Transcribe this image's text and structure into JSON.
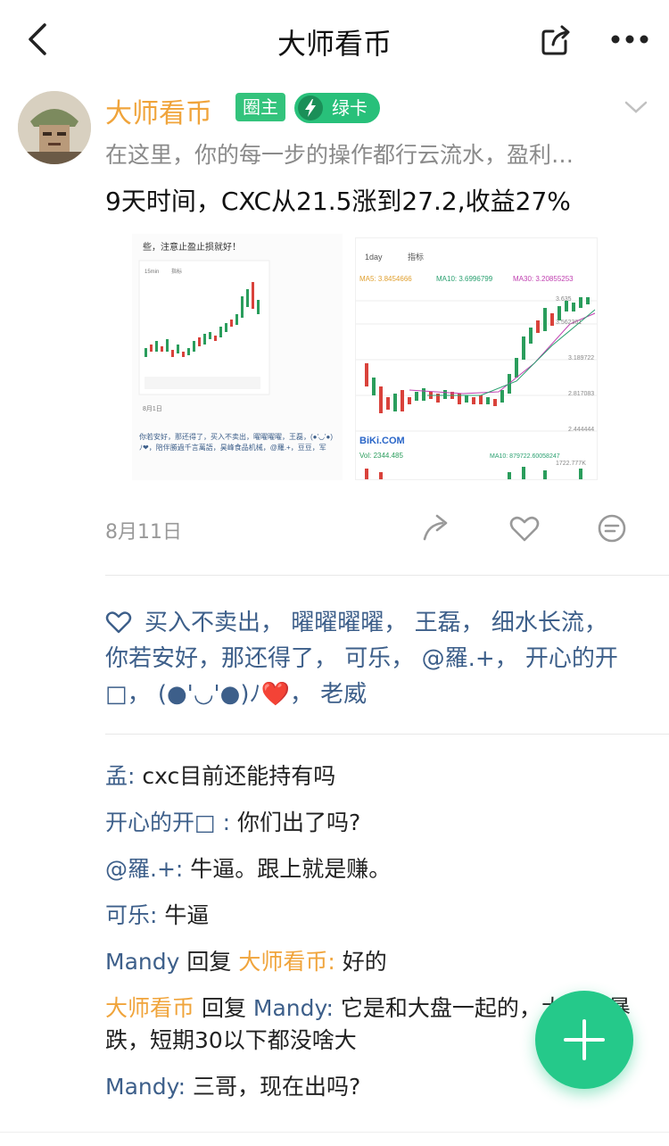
{
  "nav": {
    "title": "大师看币"
  },
  "post": {
    "author": "大师看币",
    "badge_owner": "圈主",
    "badge_card": "绿卡",
    "description": "在这里，你的每一步的操作都行云流水，盈利…",
    "text": "9天时间，CXC从21.5涨到27.2,收益27%",
    "date": "8月11日"
  },
  "image_left": {
    "top_text": "些，注意止盈止损就好！",
    "tab_interval": "15min",
    "tab_indicator": "指标",
    "date": "8月1日",
    "likes_text": "你若安好，那还得了，买入不卖出，曜曜曜曜，王磊，(●'◡'●)ﾉ❤，陪伴勝過千言萬語，昊峰食品机械，@羅.+，豆豆，军"
  },
  "image_right": {
    "tab_interval": "1day",
    "tab_indicator": "指标",
    "ma5": "MA5: 3.8454666",
    "ma10": "MA10: 3.6996799",
    "ma30": "MA30: 3.20855253",
    "price_labels": [
      "3.635",
      "3.562361",
      "3.189722",
      "2.817083",
      "2.444444"
    ],
    "logo": "BiKi.COM",
    "vol": "Vol: 2344.485",
    "vol_ma10": "MA10: 879722.60058247",
    "vol_max": "1722.777K"
  },
  "likes": {
    "names": [
      "买入不卖出",
      "曜曜曜曜",
      "王磊",
      "细水长流",
      "你若安好，那还得了",
      "可乐",
      "@羅.+",
      "开心的开□",
      "(●'◡'●)ﾉ❤️",
      "老威"
    ]
  },
  "comments": [
    {
      "name": "孟:",
      "text": " cxc目前还能持有吗"
    },
    {
      "name": "开心的开□ :",
      "text": " 你们出了吗?"
    },
    {
      "name": "@羅.+:",
      "text": " 牛逼。跟上就是赚。"
    },
    {
      "name": "可乐:",
      "text": " 牛逼"
    },
    {
      "name": "Mandy",
      "reply": " 回复 ",
      "target": "大师看币:",
      "text": " 好的"
    },
    {
      "name": "大师看币",
      "reply": " 回复 ",
      "target": "Mandy:",
      "text": " 它是和大盘一起的，大盘不暴跌，短期30以下都没啥大"
    },
    {
      "name": "Mandy:",
      "text": " 三哥，现在出吗?"
    }
  ],
  "colors": {
    "accent": "#25c98a",
    "author": "#f0a43b",
    "link": "#3d5f8a"
  }
}
